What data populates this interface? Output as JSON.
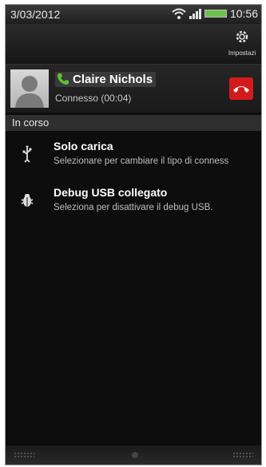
{
  "statusbar": {
    "date": "3/03/2012",
    "time": "10:56"
  },
  "topbar": {
    "settings_label": "Impostazi"
  },
  "call": {
    "caller_name": "Claire Nichols",
    "status": "Connesso (00:04)"
  },
  "section": {
    "title": "In corso"
  },
  "notifications": [
    {
      "title": "Solo carica",
      "text": "Selezionare per cambiare il tipo di conness"
    },
    {
      "title": "Debug USB collegato",
      "text": "Seleziona per disattivare il debug USB."
    }
  ],
  "colors": {
    "hangup": "#d41b1b",
    "phone_green": "#5cc531",
    "battery": "#6dc24b"
  }
}
